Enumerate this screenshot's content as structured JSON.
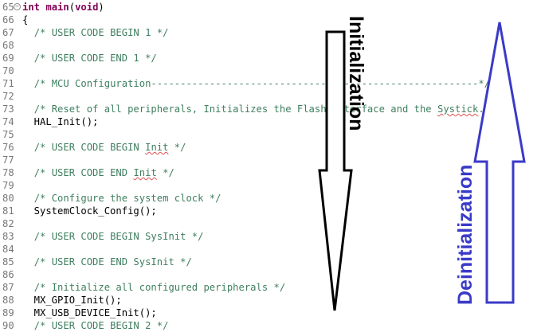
{
  "code_lines": [
    {
      "no": "65",
      "fold": true,
      "segments": [
        {
          "t": "int",
          "c": "kw"
        },
        {
          "t": " ",
          "c": ""
        },
        {
          "t": "main",
          "c": "kw"
        },
        {
          "t": "(",
          "c": ""
        },
        {
          "t": "void",
          "c": "kw"
        },
        {
          "t": ")",
          "c": ""
        }
      ]
    },
    {
      "no": "66",
      "segments": [
        {
          "t": "{",
          "c": ""
        }
      ]
    },
    {
      "no": "67",
      "segments": [
        {
          "t": "  ",
          "c": ""
        },
        {
          "t": "/* USER CODE BEGIN 1 */",
          "c": "cm"
        }
      ]
    },
    {
      "no": "68",
      "segments": []
    },
    {
      "no": "69",
      "segments": [
        {
          "t": "  ",
          "c": ""
        },
        {
          "t": "/* USER CODE END 1 */",
          "c": "cm"
        }
      ]
    },
    {
      "no": "70",
      "segments": []
    },
    {
      "no": "71",
      "segments": [
        {
          "t": "  ",
          "c": ""
        },
        {
          "t": "/* MCU Configuration--------------------------------------------------------*/",
          "c": "cm"
        }
      ]
    },
    {
      "no": "72",
      "segments": []
    },
    {
      "no": "73",
      "segments": [
        {
          "t": "  ",
          "c": ""
        },
        {
          "t": "/* Reset of all peripherals, Initializes the Flash interface and the ",
          "c": "cm"
        },
        {
          "t": "Systick",
          "c": "cm sq"
        },
        {
          "t": ". */",
          "c": "cm"
        }
      ]
    },
    {
      "no": "74",
      "segments": [
        {
          "t": "  HAL_Init();",
          "c": ""
        }
      ]
    },
    {
      "no": "75",
      "segments": []
    },
    {
      "no": "76",
      "segments": [
        {
          "t": "  ",
          "c": ""
        },
        {
          "t": "/* USER CODE BEGIN ",
          "c": "cm"
        },
        {
          "t": "Init",
          "c": "cm sq"
        },
        {
          "t": " */",
          "c": "cm"
        }
      ]
    },
    {
      "no": "77",
      "segments": []
    },
    {
      "no": "78",
      "segments": [
        {
          "t": "  ",
          "c": ""
        },
        {
          "t": "/* USER CODE END ",
          "c": "cm"
        },
        {
          "t": "Init",
          "c": "cm sq"
        },
        {
          "t": " */",
          "c": "cm"
        }
      ]
    },
    {
      "no": "79",
      "segments": []
    },
    {
      "no": "80",
      "segments": [
        {
          "t": "  ",
          "c": ""
        },
        {
          "t": "/* Configure the system clock */",
          "c": "cm"
        }
      ]
    },
    {
      "no": "81",
      "segments": [
        {
          "t": "  SystemClock_Config();",
          "c": ""
        }
      ]
    },
    {
      "no": "82",
      "segments": []
    },
    {
      "no": "83",
      "segments": [
        {
          "t": "  ",
          "c": ""
        },
        {
          "t": "/* USER CODE BEGIN SysInit */",
          "c": "cm"
        }
      ]
    },
    {
      "no": "84",
      "segments": []
    },
    {
      "no": "85",
      "segments": [
        {
          "t": "  ",
          "c": ""
        },
        {
          "t": "/* USER CODE END SysInit */",
          "c": "cm"
        }
      ]
    },
    {
      "no": "86",
      "segments": []
    },
    {
      "no": "87",
      "segments": [
        {
          "t": "  ",
          "c": ""
        },
        {
          "t": "/* Initialize all configured peripherals */",
          "c": "cm"
        }
      ]
    },
    {
      "no": "88",
      "segments": [
        {
          "t": "  MX_GPIO_Init();",
          "c": ""
        }
      ]
    },
    {
      "no": "89",
      "segments": [
        {
          "t": "  MX_USB_DEVICE_Init();",
          "c": ""
        }
      ]
    },
    {
      "no": "90",
      "segments": [
        {
          "t": "  ",
          "c": ""
        },
        {
          "t": "/* USER CODE BEGIN 2 */",
          "c": "cm"
        }
      ]
    }
  ],
  "annotations": {
    "init_label": "Initialization",
    "deinit_label": "Deinitialization",
    "init_color": "#000000",
    "deinit_color": "#3a3ac8"
  },
  "icons": {
    "fold": "collapse-minus-icon"
  }
}
